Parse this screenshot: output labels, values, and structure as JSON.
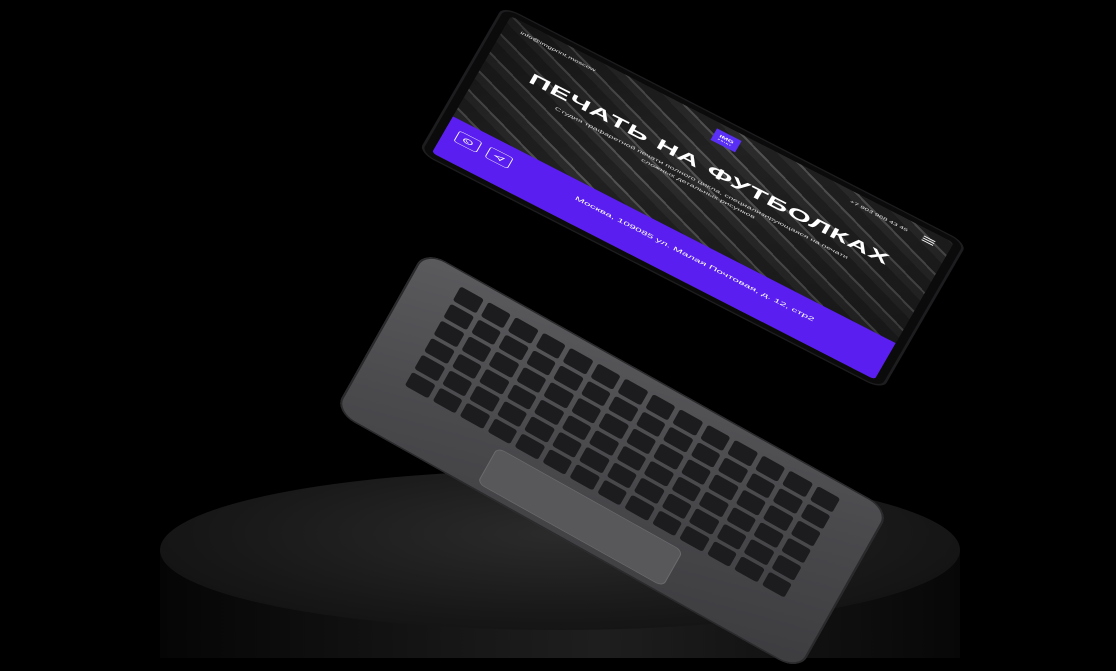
{
  "site": {
    "email": "info@imgprint.moscow",
    "logo_main": "IMG",
    "logo_sub": "PRINT",
    "phone": "+7 903 968 43 45",
    "hero_title": "ПЕЧАТЬ НА ФУТБОЛКАХ",
    "hero_subtitle": "Студия трафаретной печати полного цикла, специализирующаяся на печати сложных детальных рисунков",
    "address": "Москва, 109085 ул. Малая Почтовая, д. 12, стр2",
    "icons": [
      "whatsapp-icon",
      "telegram-icon",
      "menu-icon"
    ]
  },
  "colors": {
    "accent": "#5a1ff0",
    "background": "#000000"
  }
}
